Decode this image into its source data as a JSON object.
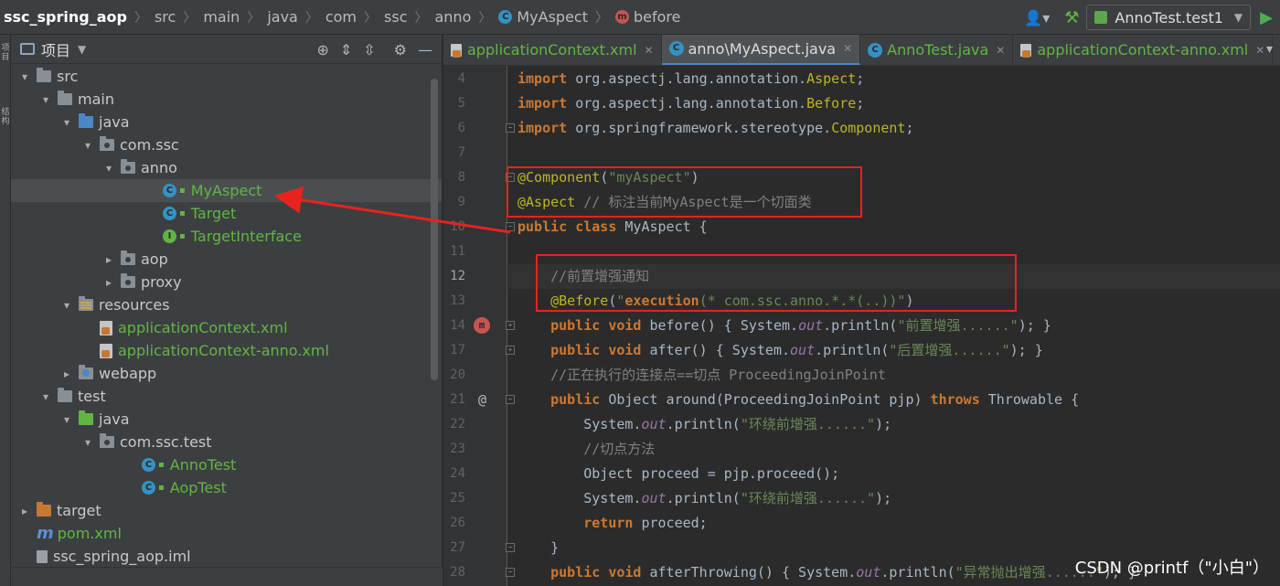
{
  "breadcrumb": {
    "items": [
      "ssc_spring_aop",
      "src",
      "main",
      "java",
      "com",
      "ssc",
      "anno",
      "MyAspect",
      "before"
    ]
  },
  "toolbar": {
    "run_config": "AnnoTest.test1"
  },
  "left_strip": {
    "tab1": "项目",
    "tab2": "结构"
  },
  "project_panel": {
    "title": "项目",
    "tree": [
      {
        "label": "src",
        "depth": 1,
        "arrow": "▾",
        "icon": "folder-grey"
      },
      {
        "label": "main",
        "depth": 2,
        "arrow": "▾",
        "icon": "folder-grey"
      },
      {
        "label": "java",
        "depth": 3,
        "arrow": "▾",
        "icon": "folder-blue"
      },
      {
        "label": "com.ssc",
        "depth": 4,
        "arrow": "▾",
        "icon": "package"
      },
      {
        "label": "anno",
        "depth": 5,
        "arrow": "▾",
        "icon": "package"
      },
      {
        "label": "MyAspect",
        "depth": 7,
        "arrow": "",
        "icon": "class",
        "green": true,
        "selected": true
      },
      {
        "label": "Target",
        "depth": 7,
        "arrow": "",
        "icon": "class",
        "green": true
      },
      {
        "label": "TargetInterface",
        "depth": 7,
        "arrow": "",
        "icon": "interface",
        "green": true
      },
      {
        "label": "aop",
        "depth": 5,
        "arrow": "▸",
        "icon": "package"
      },
      {
        "label": "proxy",
        "depth": 5,
        "arrow": "▸",
        "icon": "package"
      },
      {
        "label": "resources",
        "depth": 3,
        "arrow": "▾",
        "icon": "folder-res"
      },
      {
        "label": "applicationContext.xml",
        "depth": 4,
        "arrow": "",
        "icon": "xml",
        "green": true
      },
      {
        "label": "applicationContext-anno.xml",
        "depth": 4,
        "arrow": "",
        "icon": "xml",
        "green": true
      },
      {
        "label": "webapp",
        "depth": 3,
        "arrow": "▸",
        "icon": "folder-web"
      },
      {
        "label": "test",
        "depth": 2,
        "arrow": "▾",
        "icon": "folder-grey"
      },
      {
        "label": "java",
        "depth": 3,
        "arrow": "▾",
        "icon": "folder-green"
      },
      {
        "label": "com.ssc.test",
        "depth": 4,
        "arrow": "▾",
        "icon": "package"
      },
      {
        "label": "AnnoTest",
        "depth": 6,
        "arrow": "",
        "icon": "testclass",
        "green": true
      },
      {
        "label": "AopTest",
        "depth": 6,
        "arrow": "",
        "icon": "testclass",
        "green": true
      },
      {
        "label": "target",
        "depth": 1,
        "arrow": "▸",
        "icon": "folder-orange"
      },
      {
        "label": "pom.xml",
        "depth": 1,
        "arrow": "",
        "icon": "maven",
        "green": true
      },
      {
        "label": "ssc_spring_aop.iml",
        "depth": 1,
        "arrow": "",
        "icon": "iml"
      }
    ]
  },
  "tabs": [
    {
      "label": "applicationContext.xml",
      "icon": "xml",
      "green": true,
      "active": false
    },
    {
      "label": "anno\\MyAspect.java",
      "icon": "class",
      "green": false,
      "active": true
    },
    {
      "label": "AnnoTest.java",
      "icon": "testclass",
      "green": true,
      "active": false
    },
    {
      "label": "applicationContext-anno.xml",
      "icon": "xml",
      "green": true,
      "active": false
    }
  ],
  "editor": {
    "current_line": "12",
    "lines": [
      {
        "n": "4",
        "tokens": [
          [
            "kw",
            "import "
          ],
          [
            "",
            "org.aspectj.lang.annotation."
          ],
          [
            "ann",
            "Aspect"
          ],
          [
            "",
            ";"
          ]
        ]
      },
      {
        "n": "5",
        "tokens": [
          [
            "kw",
            "import "
          ],
          [
            "",
            "org.aspectj.lang.annotation."
          ],
          [
            "ann",
            "Before"
          ],
          [
            "",
            ";"
          ]
        ]
      },
      {
        "n": "6",
        "tokens": [
          [
            "kw",
            "import "
          ],
          [
            "",
            "org.springframework.stereotype."
          ],
          [
            "ann",
            "Component"
          ],
          [
            "",
            ";"
          ]
        ]
      },
      {
        "n": "7",
        "tokens": []
      },
      {
        "n": "8",
        "tokens": [
          [
            "ann",
            "@Component"
          ],
          [
            "",
            "("
          ],
          [
            "str",
            "\"myAspect\""
          ],
          [
            "",
            ")"
          ]
        ]
      },
      {
        "n": "9",
        "tokens": [
          [
            "ann",
            "@Aspect"
          ],
          [
            "cm",
            " // 标注当前MyAspect是一个切面类"
          ]
        ]
      },
      {
        "n": "10",
        "tokens": [
          [
            "kw",
            "public class "
          ],
          [
            "",
            "MyAspect {"
          ]
        ]
      },
      {
        "n": "11",
        "tokens": []
      },
      {
        "n": "12",
        "tokens": [
          [
            "cm",
            "    //前置增强通知"
          ]
        ]
      },
      {
        "n": "13",
        "tokens": [
          [
            "ann",
            "    @Before"
          ],
          [
            "",
            "("
          ],
          [
            "str",
            "\""
          ],
          [
            "kw",
            "execution"
          ],
          [
            "str",
            "(* com.ssc.anno.*.*(..))\""
          ],
          [
            "",
            ")"
          ]
        ]
      },
      {
        "n": "14",
        "tokens": [
          [
            "kw",
            "    public void "
          ],
          [
            "",
            "before() "
          ],
          [
            "",
            "{ System."
          ],
          [
            "fld",
            "out"
          ],
          [
            "",
            ".println("
          ],
          [
            "str",
            "\"前置增强......\""
          ],
          [
            "",
            "); }"
          ]
        ]
      },
      {
        "n": "17",
        "tokens": [
          [
            "kw",
            "    public void "
          ],
          [
            "",
            "after() "
          ],
          [
            "",
            "{ System."
          ],
          [
            "fld",
            "out"
          ],
          [
            "",
            ".println("
          ],
          [
            "str",
            "\"后置增强......\""
          ],
          [
            "",
            "); }"
          ]
        ]
      },
      {
        "n": "20",
        "tokens": [
          [
            "cm",
            "    //正在执行的连接点==切点 ProceedingJoinPoint"
          ]
        ]
      },
      {
        "n": "21",
        "tokens": [
          [
            "kw",
            "    public "
          ],
          [
            "",
            "Object around(ProceedingJoinPoint pjp) "
          ],
          [
            "kw",
            "throws "
          ],
          [
            "",
            "Throwable {"
          ]
        ]
      },
      {
        "n": "22",
        "tokens": [
          [
            "",
            "        System."
          ],
          [
            "fld",
            "out"
          ],
          [
            "",
            ".println("
          ],
          [
            "str",
            "\"环绕前增强......\""
          ],
          [
            "",
            ");"
          ]
        ]
      },
      {
        "n": "23",
        "tokens": [
          [
            "cm",
            "        //切点方法"
          ]
        ]
      },
      {
        "n": "24",
        "tokens": [
          [
            "",
            "        Object proceed = pjp.proceed();"
          ]
        ]
      },
      {
        "n": "25",
        "tokens": [
          [
            "",
            "        System."
          ],
          [
            "fld",
            "out"
          ],
          [
            "",
            ".println("
          ],
          [
            "str",
            "\"环绕前增强......\""
          ],
          [
            "",
            ");"
          ]
        ]
      },
      {
        "n": "26",
        "tokens": [
          [
            "kw",
            "        return "
          ],
          [
            "",
            "proceed;"
          ]
        ]
      },
      {
        "n": "27",
        "tokens": [
          [
            "",
            "    }"
          ]
        ]
      },
      {
        "n": "28",
        "tokens": [
          [
            "kw",
            "    public void "
          ],
          [
            "",
            "afterThrowing() "
          ],
          [
            "",
            "{ System."
          ],
          [
            "fld",
            "out"
          ],
          [
            "",
            ".println("
          ],
          [
            "str",
            "\"异常抛出增强......\""
          ],
          [
            "",
            "); }"
          ]
        ]
      }
    ]
  },
  "watermark": "CSDN @printf（\"小白\"）",
  "colors": {
    "annotation_box": "#e8231d",
    "accent": "#4a88c7"
  }
}
